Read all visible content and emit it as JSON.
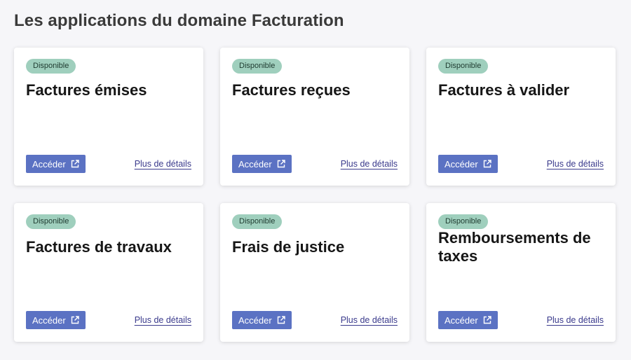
{
  "page": {
    "title": "Les applications du domaine Facturation"
  },
  "cards": [
    {
      "status": "Disponible",
      "title": "Factures émises",
      "access_label": "Accéder",
      "details_label": "Plus de détails"
    },
    {
      "status": "Disponible",
      "title": "Factures reçues",
      "access_label": "Accéder",
      "details_label": "Plus de détails"
    },
    {
      "status": "Disponible",
      "title": "Factures à valider",
      "access_label": "Accéder",
      "details_label": "Plus de détails"
    },
    {
      "status": "Disponible",
      "title": "Factures de travaux",
      "access_label": "Accéder",
      "details_label": "Plus de détails"
    },
    {
      "status": "Disponible",
      "title": "Frais de justice",
      "access_label": "Accéder",
      "details_label": "Plus de détails"
    },
    {
      "status": "Disponible",
      "title": "Remboursements de taxes",
      "access_label": "Accéder",
      "details_label": "Plus de détails"
    }
  ],
  "icons": {
    "access": "external-link-icon"
  },
  "colors": {
    "button": "#5b72c3",
    "badge": "#9fcfbd",
    "link": "#3a3a8c",
    "background": "#f6f6f9"
  }
}
